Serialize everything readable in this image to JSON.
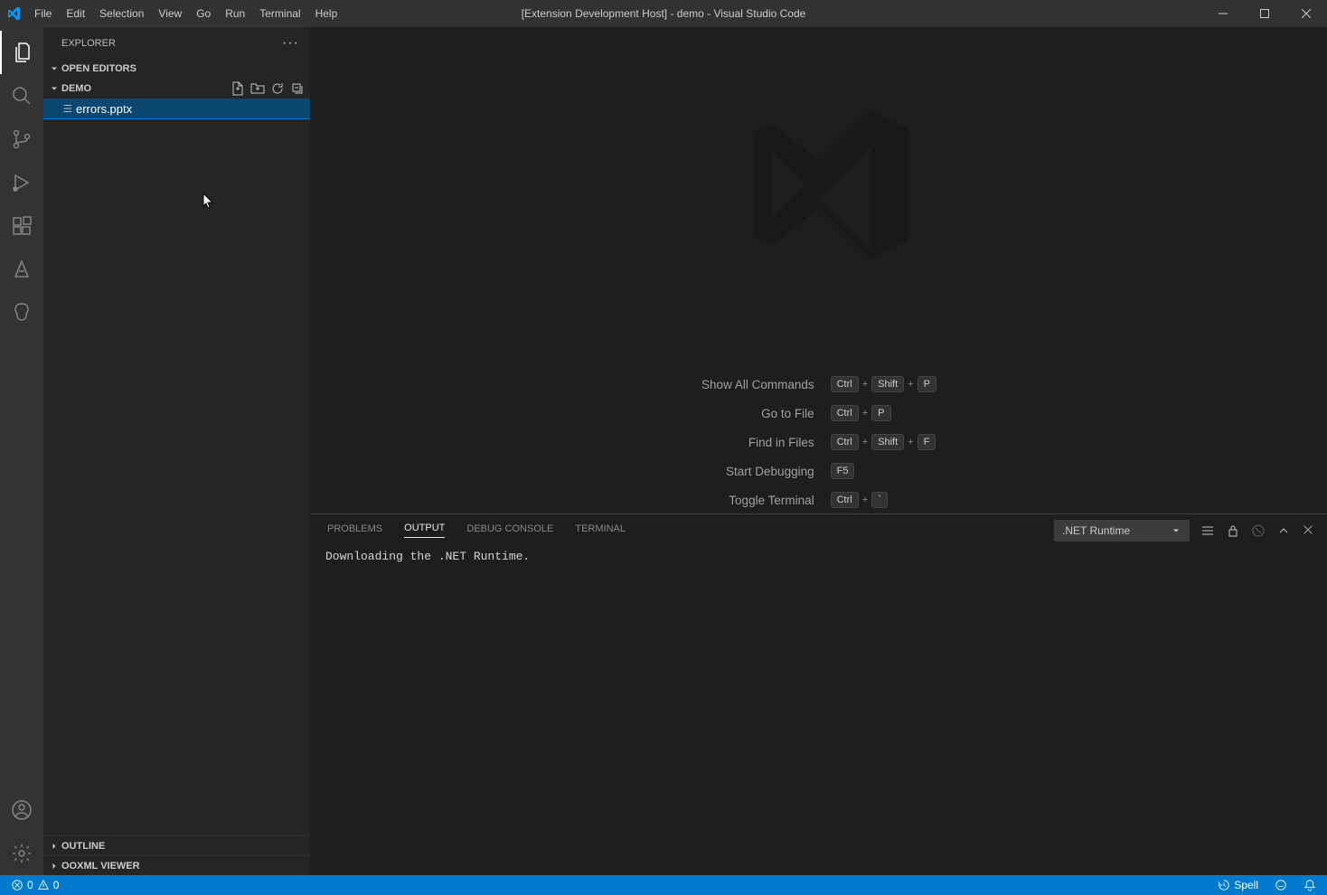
{
  "titlebar": {
    "title": "[Extension Development Host] - demo - Visual Studio Code",
    "menus": [
      "File",
      "Edit",
      "Selection",
      "View",
      "Go",
      "Run",
      "Terminal",
      "Help"
    ]
  },
  "sidebar": {
    "title": "EXPLORER",
    "sections": {
      "open_editors": "OPEN EDITORS",
      "folder": "DEMO",
      "outline": "OUTLINE",
      "ooxml": "OOXML VIEWER"
    },
    "files": [
      {
        "name": "errors.pptx"
      }
    ]
  },
  "welcome": {
    "shortcuts": [
      {
        "label": "Show All Commands",
        "keys": [
          "Ctrl",
          "Shift",
          "P"
        ]
      },
      {
        "label": "Go to File",
        "keys": [
          "Ctrl",
          "P"
        ]
      },
      {
        "label": "Find in Files",
        "keys": [
          "Ctrl",
          "Shift",
          "F"
        ]
      },
      {
        "label": "Start Debugging",
        "keys": [
          "F5"
        ]
      },
      {
        "label": "Toggle Terminal",
        "keys": [
          "Ctrl",
          "`"
        ]
      }
    ]
  },
  "panel": {
    "tabs": [
      "PROBLEMS",
      "OUTPUT",
      "DEBUG CONSOLE",
      "TERMINAL"
    ],
    "active_tab": "OUTPUT",
    "channel": ".NET Runtime",
    "content": "Downloading the .NET Runtime."
  },
  "statusbar": {
    "errors": "0",
    "warnings": "0",
    "spell": "Spell"
  }
}
